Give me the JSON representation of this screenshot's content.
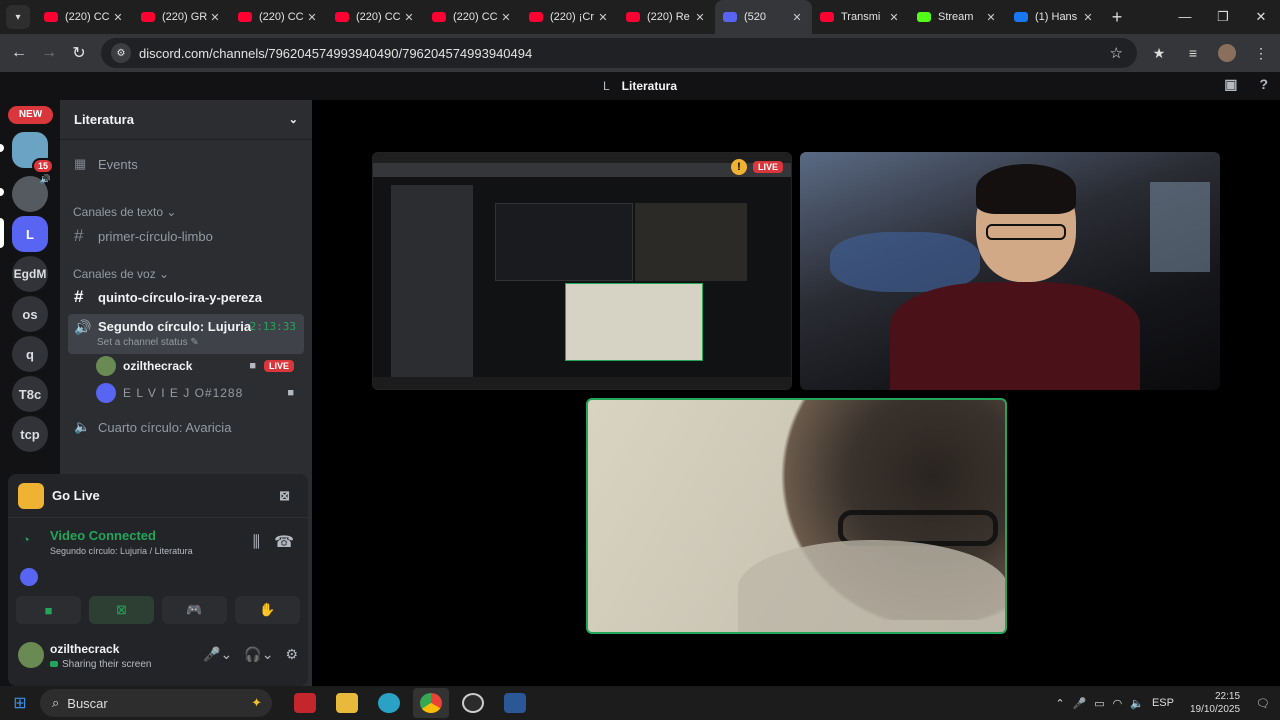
{
  "browser": {
    "tabs": [
      {
        "label": "(220) CC",
        "icon": "youtube-icon",
        "color": "#ff0033"
      },
      {
        "label": "(220) GR",
        "icon": "youtube-icon",
        "color": "#ff0033"
      },
      {
        "label": "(220) CC",
        "icon": "youtube-icon",
        "color": "#ff0033"
      },
      {
        "label": "(220) CC",
        "icon": "youtube-icon",
        "color": "#ff0033"
      },
      {
        "label": "(220) CC",
        "icon": "youtube-icon",
        "color": "#ff0033"
      },
      {
        "label": "(220) ¡Cr",
        "icon": "youtube-icon",
        "color": "#ff0033"
      },
      {
        "label": "(220) Re",
        "icon": "youtube-icon",
        "color": "#ff0033"
      },
      {
        "label": "(520",
        "icon": "discord-icon",
        "color": "#5865f2",
        "active": true
      },
      {
        "label": "Transmi",
        "icon": "youtube-icon",
        "color": "#ff0033"
      },
      {
        "label": "Stream",
        "icon": "kick-icon",
        "color": "#53fc18"
      },
      {
        "label": "(1) Hans",
        "icon": "facebook-icon",
        "color": "#1877f2"
      }
    ],
    "url": "discord.com/channels/796204574993940490/796204574993940494",
    "discord_badge": "520"
  },
  "discord": {
    "title_prefix": "L",
    "title": "Literatura",
    "guilds": [
      {
        "label": "NEW"
      },
      {
        "badge": "15"
      },
      {
        "label": "L"
      },
      {
        "label": "EgdM"
      },
      {
        "label": "os"
      },
      {
        "label": "q"
      },
      {
        "label": "T8c"
      },
      {
        "label": "tcp"
      }
    ],
    "server_name": "Literatura",
    "events_label": "Events",
    "text_category": "Canales de texto",
    "text_channels": [
      "primer-círculo-limbo"
    ],
    "voice_category": "Canales de voz",
    "channel_quinto": "quinto-círculo-ira-y-pereza",
    "active_voice": {
      "name": "Segundo círculo: Lujuria",
      "timer": "2:13:33",
      "status": "Set a channel status"
    },
    "voice_users": [
      {
        "name": "ozilthecrack",
        "live": "LIVE"
      },
      {
        "name": "E L V I E J O#1288"
      }
    ],
    "other_voice": "Cuarto círculo: Avaricia",
    "go_live": "Go Live",
    "connection": {
      "title": "Video Connected",
      "subtitle": "Segundo círculo: Lujuria / Literatura"
    },
    "user": {
      "name": "ozilthecrack",
      "status": "Sharing their screen"
    },
    "stream_live": "LIVE",
    "accent_green": "#23a55a",
    "live_red": "#da373c"
  },
  "taskbar": {
    "search_placeholder": "Buscar",
    "lang": "ESP",
    "time": "22:15",
    "date": "19/10/2025"
  }
}
